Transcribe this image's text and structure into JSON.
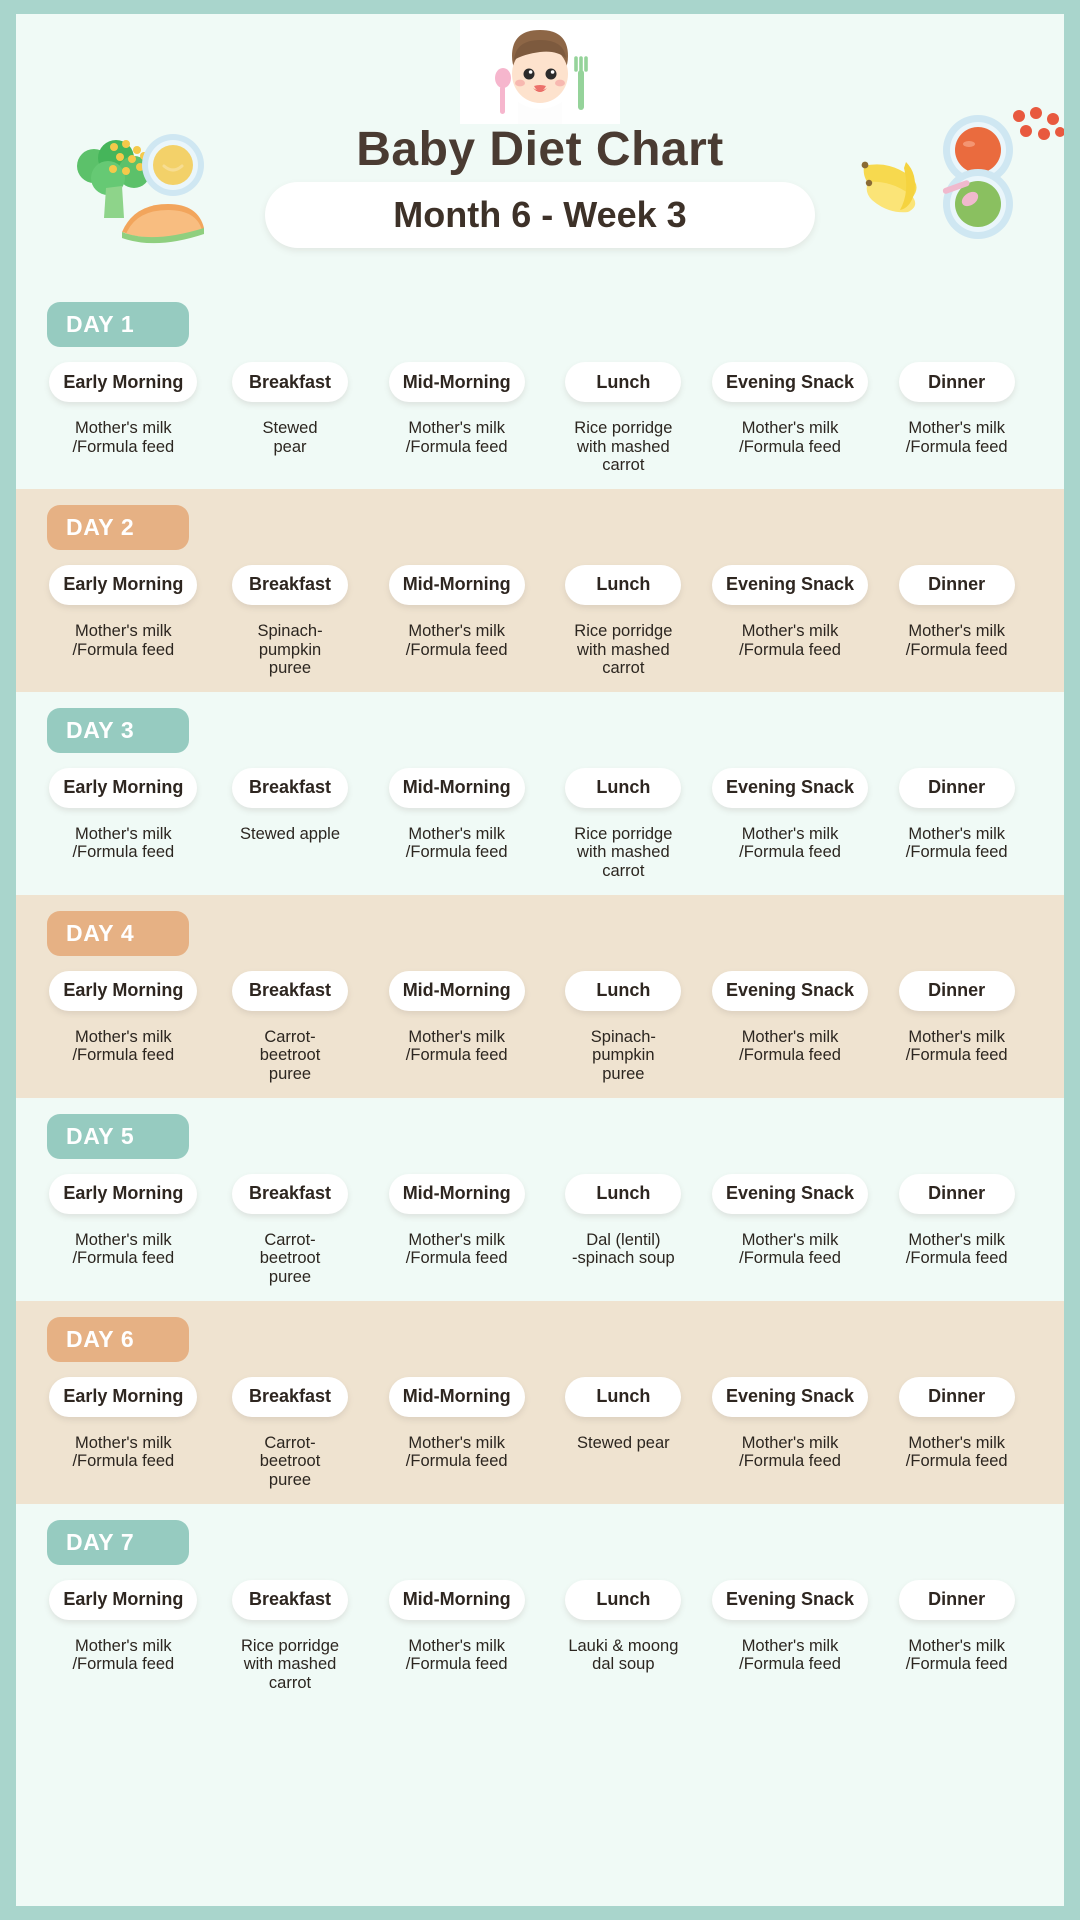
{
  "header": {
    "title": "Baby Diet Chart",
    "subtitle": "Month 6 - Week 3",
    "logo_icon": "baby-face-icon",
    "decorations": [
      "broccoli-icon",
      "corn-kernels-icon",
      "yellow-puree-bowl-icon",
      "pumpkin-slice-icon",
      "banana-bunch-icon",
      "tomato-puree-bowl-icon",
      "berries-icon",
      "green-puree-bowl-icon"
    ]
  },
  "colors": {
    "border": "#a9d5cc",
    "mint_band": "#f0faf6",
    "cream_band": "#efe3d0",
    "teal_badge": "#96cbc0",
    "peach_badge": "#e6b184",
    "title_text": "#4a3b32"
  },
  "meal_labels": [
    "Early Morning",
    "Breakfast",
    "Mid-Morning",
    "Lunch",
    "Evening Snack",
    "Dinner"
  ],
  "days": [
    {
      "label": "DAY 1",
      "theme": "mint",
      "meals": [
        "Mother's milk\n/Formula feed",
        "Stewed\npear",
        "Mother's milk\n/Formula feed",
        "Rice porridge\nwith mashed\ncarrot",
        "Mother's milk\n/Formula feed",
        "Mother's milk\n/Formula feed"
      ]
    },
    {
      "label": "DAY 2",
      "theme": "cream",
      "meals": [
        "Mother's milk\n/Formula feed",
        "Spinach-\npumpkin\npuree",
        "Mother's milk\n/Formula feed",
        "Rice porridge\nwith mashed\ncarrot",
        "Mother's milk\n/Formula feed",
        "Mother's milk\n/Formula feed"
      ]
    },
    {
      "label": "DAY 3",
      "theme": "mint",
      "meals": [
        "Mother's milk\n/Formula feed",
        "Stewed apple",
        "Mother's milk\n/Formula feed",
        "Rice porridge\nwith mashed\ncarrot",
        "Mother's milk\n/Formula feed",
        "Mother's milk\n/Formula feed"
      ]
    },
    {
      "label": "DAY 4",
      "theme": "cream",
      "meals": [
        "Mother's milk\n/Formula feed",
        "Carrot-\nbeetroot\npuree",
        "Mother's milk\n/Formula feed",
        "Spinach-\npumpkin\npuree",
        "Mother's milk\n/Formula feed",
        "Mother's milk\n/Formula feed"
      ]
    },
    {
      "label": "DAY 5",
      "theme": "mint",
      "meals": [
        "Mother's milk\n/Formula feed",
        "Carrot-\nbeetroot\npuree",
        "Mother's milk\n/Formula feed",
        "Dal (lentil)\n-spinach soup",
        "Mother's milk\n/Formula feed",
        "Mother's milk\n/Formula feed"
      ]
    },
    {
      "label": "DAY 6",
      "theme": "cream",
      "meals": [
        "Mother's milk\n/Formula feed",
        "Carrot-\nbeetroot\npuree",
        "Mother's milk\n/Formula feed",
        "Stewed pear",
        "Mother's milk\n/Formula feed",
        "Mother's milk\n/Formula feed"
      ]
    },
    {
      "label": "DAY 7",
      "theme": "mint",
      "meals": [
        "Mother's milk\n/Formula feed",
        "Rice porridge\nwith mashed\ncarrot",
        "Mother's milk\n/Formula feed",
        "Lauki & moong\ndal soup",
        "Mother's milk\n/Formula feed",
        "Mother's milk\n/Formula feed"
      ]
    }
  ]
}
